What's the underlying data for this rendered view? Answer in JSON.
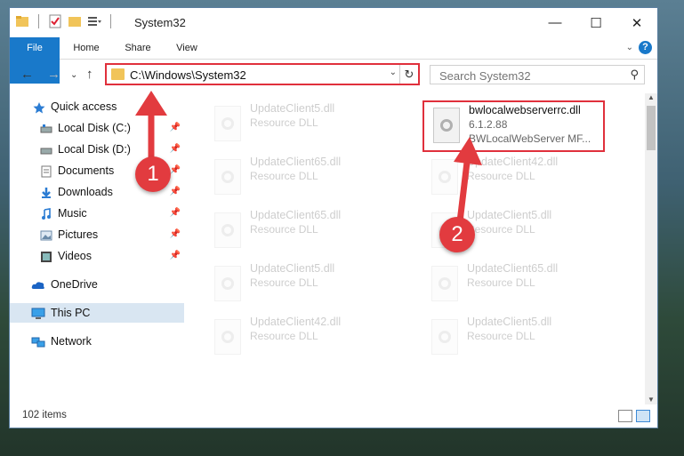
{
  "window": {
    "title": "System32"
  },
  "ribbon": {
    "tabs": [
      "File",
      "Home",
      "Share",
      "View"
    ],
    "help_label": "?"
  },
  "address": {
    "path": "C:\\Windows\\System32",
    "dropdown_icon": "chevron-down-icon",
    "refresh_icon": "refresh-icon"
  },
  "search": {
    "placeholder": "Search System32"
  },
  "nav": {
    "items": [
      {
        "label": "Quick access",
        "icon": "star-icon",
        "pinned": false,
        "selected": false
      },
      {
        "label": "Local Disk (C:)",
        "icon": "drive-icon",
        "pinned": true,
        "selected": false
      },
      {
        "label": "Local Disk (D:)",
        "icon": "drive-icon",
        "pinned": true,
        "selected": false
      },
      {
        "label": "Documents",
        "icon": "documents-icon",
        "pinned": true,
        "selected": false
      },
      {
        "label": "Downloads",
        "icon": "download-icon",
        "pinned": true,
        "selected": false
      },
      {
        "label": "Music",
        "icon": "music-icon",
        "pinned": true,
        "selected": false
      },
      {
        "label": "Pictures",
        "icon": "pictures-icon",
        "pinned": true,
        "selected": false
      },
      {
        "label": "Videos",
        "icon": "videos-icon",
        "pinned": true,
        "selected": false
      },
      {
        "label": "OneDrive",
        "icon": "cloud-icon",
        "pinned": false,
        "selected": false
      },
      {
        "label": "This PC",
        "icon": "computer-icon",
        "pinned": false,
        "selected": true
      },
      {
        "label": "Network",
        "icon": "network-icon",
        "pinned": false,
        "selected": false
      }
    ]
  },
  "files": {
    "highlighted": {
      "name": "bwlocalwebserverrc.dll",
      "version": "6.1.2.88",
      "description": "BWLocalWebServer MF..."
    },
    "faded": [
      {
        "name": "UpdateClient5.dll",
        "type": "Resource DLL"
      },
      {
        "name": "UpdateClient65.dll",
        "type": "Resource DLL"
      },
      {
        "name": "UpdateClient42.dll",
        "type": "Resource DLL"
      },
      {
        "name": "UpdateClient65.dll",
        "type": "Resource DLL"
      },
      {
        "name": "UpdateClient5.dll",
        "type": "Resource DLL"
      },
      {
        "name": "UpdateClient5.dll",
        "type": "Resource DLL"
      },
      {
        "name": "UpdateClient65.dll",
        "type": "Resource DLL"
      },
      {
        "name": "UpdateClient42.dll",
        "type": "Resource DLL"
      },
      {
        "name": "UpdateClient5.dll",
        "type": "Resource DLL"
      }
    ]
  },
  "status": {
    "item_count": "102 items"
  },
  "annotations": {
    "step1": "1",
    "step2": "2",
    "highlight_color": "#e0303c"
  }
}
